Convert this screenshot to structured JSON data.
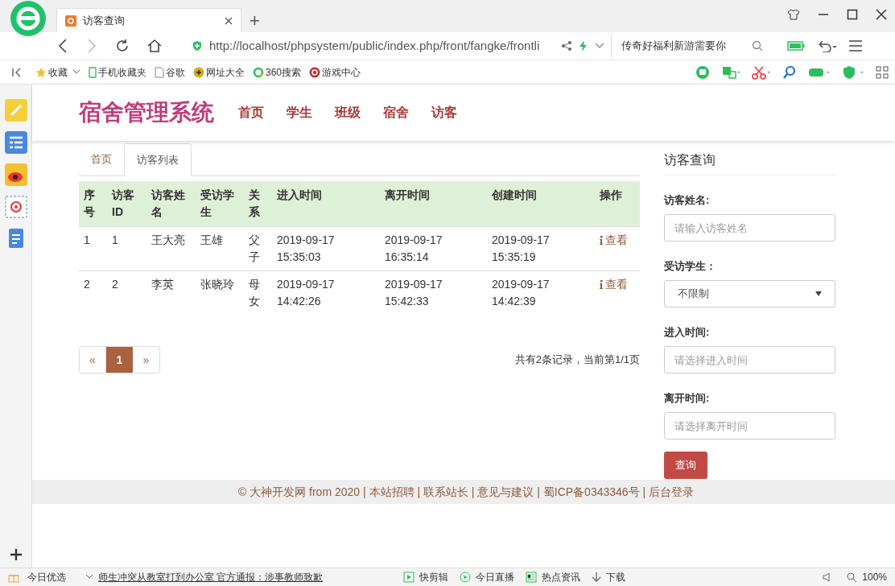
{
  "browser": {
    "tab_title": "访客查询",
    "new_tab": "+",
    "url": "http://localhost/phpsystem/public/index.php/front/fangke/frontli",
    "search_text": "传奇好福利新游需要你",
    "bookmarks": [
      {
        "kind": "star",
        "label": "收藏"
      },
      {
        "kind": "phone",
        "label": "手机收藏夹"
      },
      {
        "kind": "doc",
        "label": "谷歌"
      },
      {
        "kind": "web",
        "label": "网址大全"
      },
      {
        "kind": "search",
        "label": "360搜索"
      },
      {
        "kind": "game",
        "label": "游戏中心"
      }
    ]
  },
  "header": {
    "title": "宿舍管理系统",
    "nav": [
      "首页",
      "学生",
      "班级",
      "宿舍",
      "访客"
    ]
  },
  "tabs": [
    {
      "label": "首页",
      "selected": false
    },
    {
      "label": "访客列表",
      "selected": true
    }
  ],
  "table": {
    "columns": [
      "序号",
      "访客ID",
      "访客姓名",
      "受访学生",
      "关系",
      "进入时间",
      "离开时间",
      "创建时间",
      "操作"
    ],
    "rows": [
      {
        "cells": [
          "1",
          "1",
          "王大亮",
          "王雄",
          "父子",
          "2019-09-17 15:35:03",
          "2019-09-17 16:35:14",
          "2019-09-17 15:35:19"
        ],
        "action": "查看"
      },
      {
        "cells": [
          "2",
          "2",
          "李英",
          "张晓玲",
          "母女",
          "2019-09-17 14:42:26",
          "2019-09-17 15:42:33",
          "2019-09-17 14:42:39"
        ],
        "action": "查看"
      }
    ]
  },
  "pagination": {
    "prev": "«",
    "pages": [
      {
        "label": "1",
        "selected": true
      }
    ],
    "next": "»",
    "summary": "共有2条记录，当前第1/1页"
  },
  "search_panel": {
    "title": "访客查询",
    "fields": [
      {
        "kind": "text",
        "label": "访客姓名:",
        "placeholder": "请输入访客姓名"
      },
      {
        "kind": "select",
        "label": "受访学生：",
        "value": "不限制"
      },
      {
        "kind": "text",
        "label": "进入时间:",
        "placeholder": "请选择进入时间"
      },
      {
        "kind": "text",
        "label": "离开时间:",
        "placeholder": "请选择离开时间"
      }
    ],
    "button": "查询"
  },
  "footer": "© 大神开发网 from 2020 | 本站招聘 | 联系站长 | 意见与建议 | 蜀ICP备0343346号 | 后台登录",
  "status_bar": {
    "left": "今日优选",
    "news": "师生冲突从教室打到办公室 官方通报：涉事教师致歉",
    "items": [
      "快剪辑",
      "今日直播",
      "热点资讯",
      "下载"
    ],
    "zoom": "100%"
  }
}
